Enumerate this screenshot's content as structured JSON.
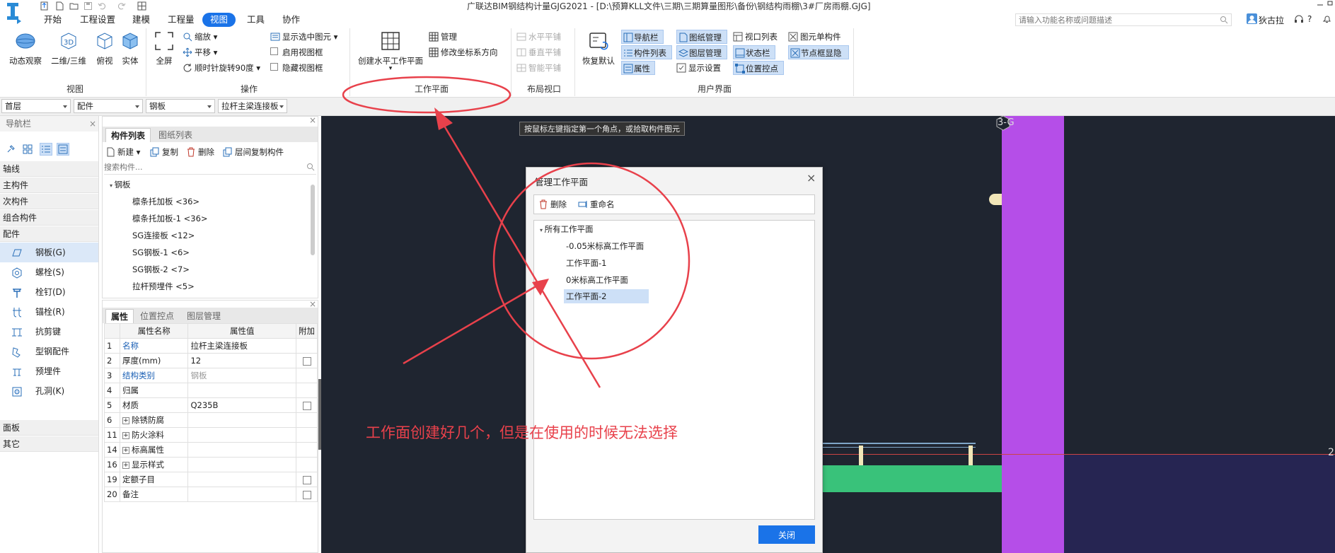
{
  "app": {
    "title": "广联达BIM钢结构计量GJG2021 - [D:\\预算KLL文件\\三期\\三期算量图形\\备份\\钢结构雨棚\\3#厂房雨棚.GJG]",
    "user": "狄古拉",
    "help": "?"
  },
  "menu": [
    "开始",
    "工程设置",
    "建模",
    "工程量",
    "视图",
    "工具",
    "协作"
  ],
  "search": {
    "placeholder": "请输入功能名称或问题描述"
  },
  "ribbon": {
    "view_group": {
      "label": "视图",
      "buttons": [
        "动态观察",
        "二维/三维",
        "俯视",
        "实体"
      ]
    },
    "operate_group": {
      "label": "操作",
      "fullscreen": "全屏",
      "zoom": "缩放",
      "pan": "平移",
      "rotate": "顺时针旋转90度",
      "show_selected": "显示选中图元",
      "enable_viewframe": "启用视图框",
      "hide_viewframe": "隐藏视图框"
    },
    "workplane_group": {
      "label": "工作平面",
      "create": "创建水平工作平面",
      "manage": "管理",
      "modify_axis": "修改坐标系方向"
    },
    "layout_group": {
      "label": "布局视口",
      "items": [
        "水平平铺",
        "垂直平铺",
        "智能平铺"
      ]
    },
    "ui_group": {
      "label": "用户界面",
      "restore": "恢复默认",
      "col1": [
        "导航栏",
        "构件列表",
        "属性"
      ],
      "col2": [
        "图纸管理",
        "图层管理",
        "显示设置"
      ],
      "col3": [
        "视口列表",
        "状态栏",
        "位置控点"
      ],
      "col4": [
        "图元单构件",
        "节点框显隐"
      ]
    }
  },
  "combos": [
    "首层",
    "配件",
    "钢板",
    "拉杆主梁连接板"
  ],
  "nav": {
    "title": "导航栏",
    "categories": [
      "轴线",
      "主构件",
      "次构件",
      "组合构件",
      "配件"
    ],
    "items": [
      "钢板(G)",
      "螺栓(S)",
      "栓钉(D)",
      "锚栓(R)",
      "抗剪键",
      "型钢配件",
      "预埋件",
      "孔洞(K)"
    ],
    "bottom": [
      "面板",
      "其它"
    ]
  },
  "complist": {
    "tabs": [
      "构件列表",
      "图纸列表"
    ],
    "toolbar": {
      "new": "新建",
      "copy": "复制",
      "delete": "删除",
      "floor_copy": "层间复制构件"
    },
    "search_placeholder": "搜索构件...",
    "root": "钢板",
    "items": [
      "檩条托加板 <36>",
      "檩条托加板-1 <36>",
      "SG连接板 <12>",
      "SG钢板-1 <6>",
      "SG钢板-2 <7>",
      "拉杆预埋件 <5>"
    ]
  },
  "props": {
    "tabs": [
      "属性",
      "位置控点",
      "图层管理"
    ],
    "headers": [
      "属性名称",
      "属性值",
      "附加"
    ],
    "rows": [
      {
        "no": "1",
        "name": "名称",
        "value": "拉杆主梁连接板"
      },
      {
        "no": "2",
        "name": "厚度(mm)",
        "value": "12"
      },
      {
        "no": "3",
        "name": "结构类别",
        "value": "钢板"
      },
      {
        "no": "4",
        "name": "归属",
        "value": ""
      },
      {
        "no": "5",
        "name": "材质",
        "value": "Q235B"
      },
      {
        "no": "6",
        "name": "除锈防腐",
        "value": ""
      },
      {
        "no": "11",
        "name": "防火涂料",
        "value": ""
      },
      {
        "no": "14",
        "name": "标高属性",
        "value": ""
      },
      {
        "no": "16",
        "name": "显示样式",
        "value": ""
      },
      {
        "no": "19",
        "name": "定额子目",
        "value": ""
      },
      {
        "no": "20",
        "name": "备注",
        "value": ""
      }
    ]
  },
  "canvas": {
    "hint": "按鼠标左键指定第一个角点，或拾取构件图元",
    "axis_label_top": "3-G",
    "axis_label_right": "2",
    "annotation": "工作面创建好几个，但是在使用的时候无法选择"
  },
  "dialog": {
    "title": "管理工作平面",
    "delete": "删除",
    "rename": "重命名",
    "root": "所有工作平面",
    "items": [
      "-0.05米标高工作平面",
      "工作平面-1",
      "0米标高工作平面",
      "工作平面-2"
    ],
    "selected_index": 3,
    "close": "关闭"
  },
  "colors": {
    "accent": "#1a73e8",
    "annotation_red": "#e8414b",
    "column_purple": "#b54ee8",
    "beam_green": "#39c27a",
    "canvas_bg": "#1f2530"
  }
}
